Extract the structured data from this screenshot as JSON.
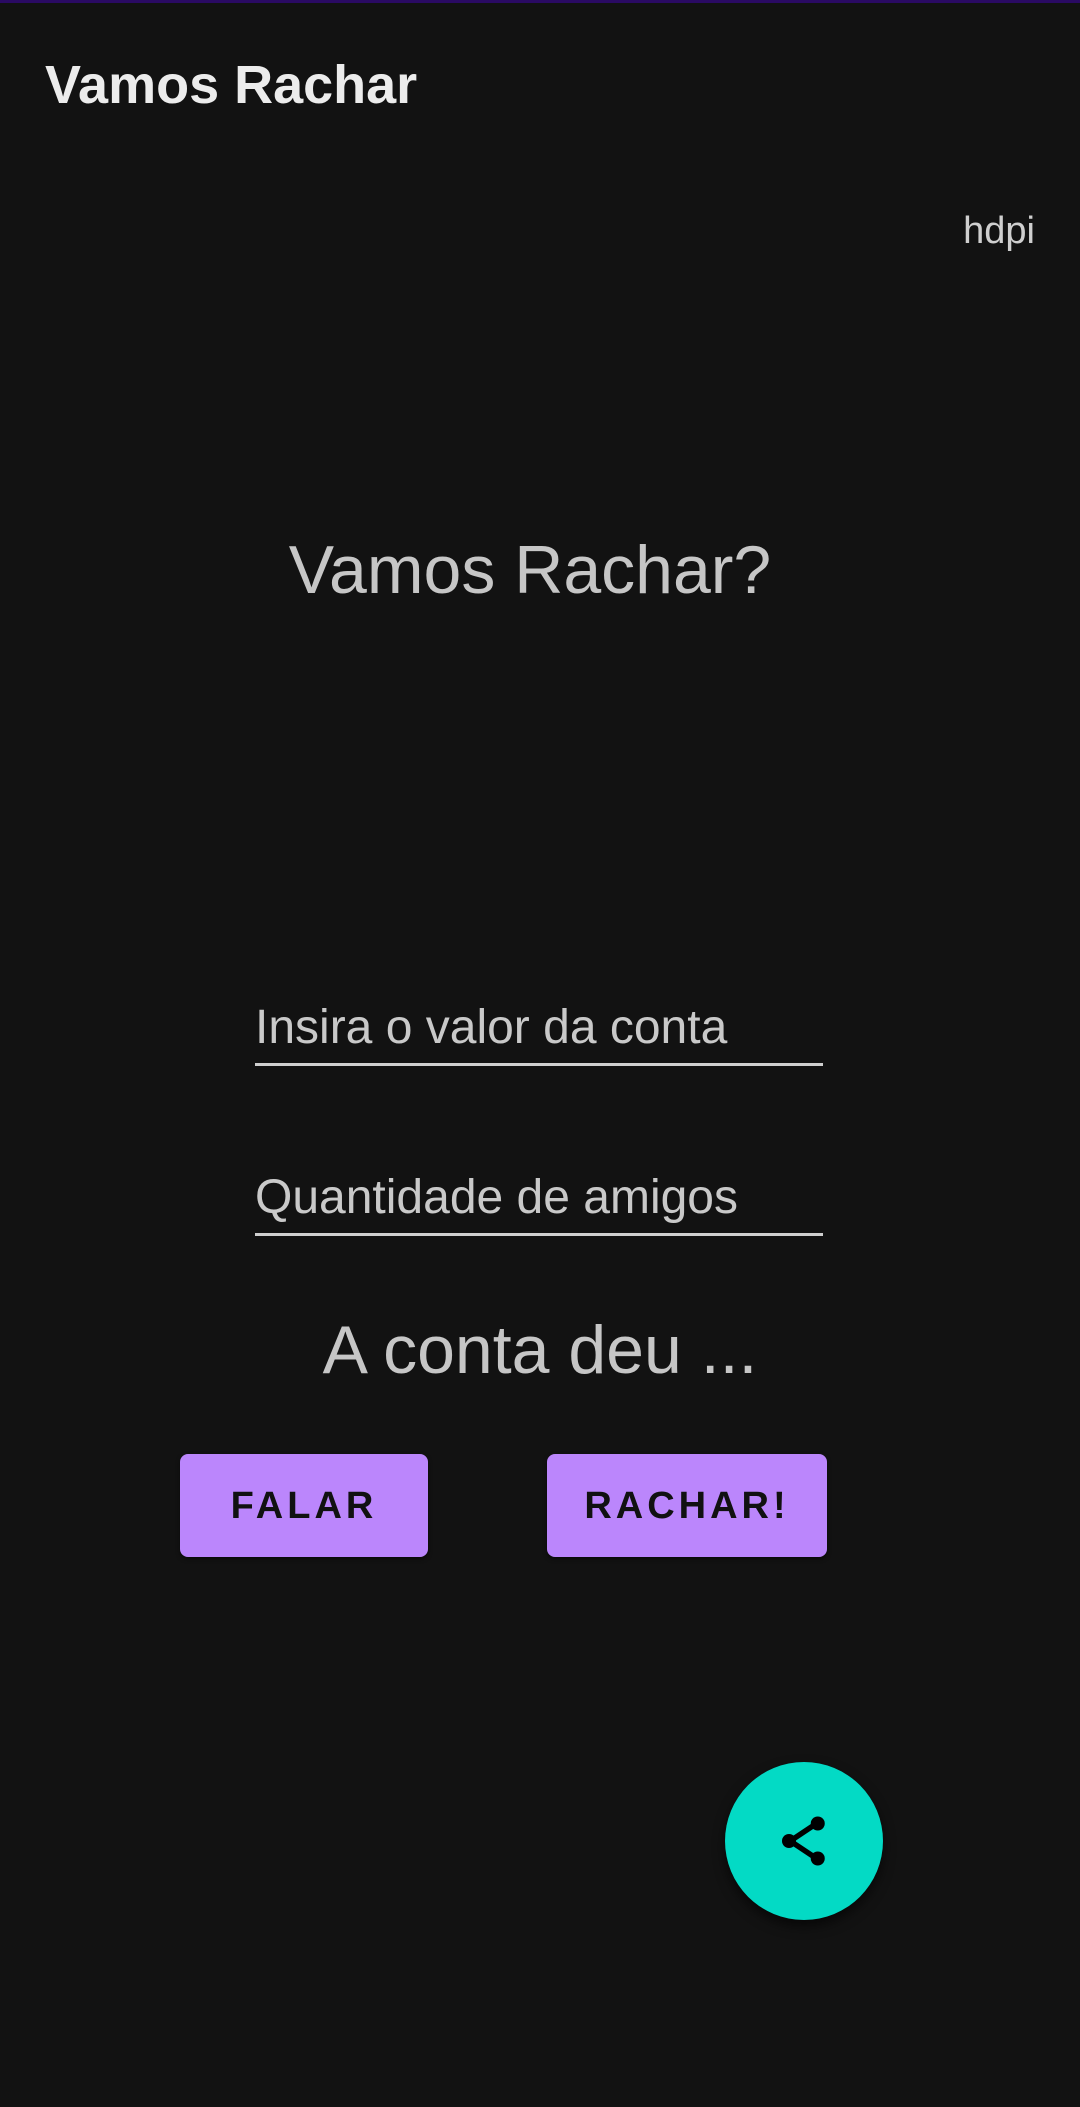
{
  "app_bar": {
    "title": "Vamos Rachar"
  },
  "density_label": "hdpi",
  "headline": "Vamos Rachar?",
  "form": {
    "bill_placeholder": "Insira o valor da conta",
    "bill_value": "",
    "friends_placeholder": "Quantidade de amigos",
    "friends_value": ""
  },
  "result_text": "A conta deu ...",
  "buttons": {
    "speak_label": "FALAR",
    "split_label": "RACHAR!"
  },
  "fab": {
    "icon": "share-icon"
  },
  "colors": {
    "background": "#121212",
    "primary": "#bb86fc",
    "secondary": "#03dac5",
    "status_strip": "#2a0a63"
  }
}
